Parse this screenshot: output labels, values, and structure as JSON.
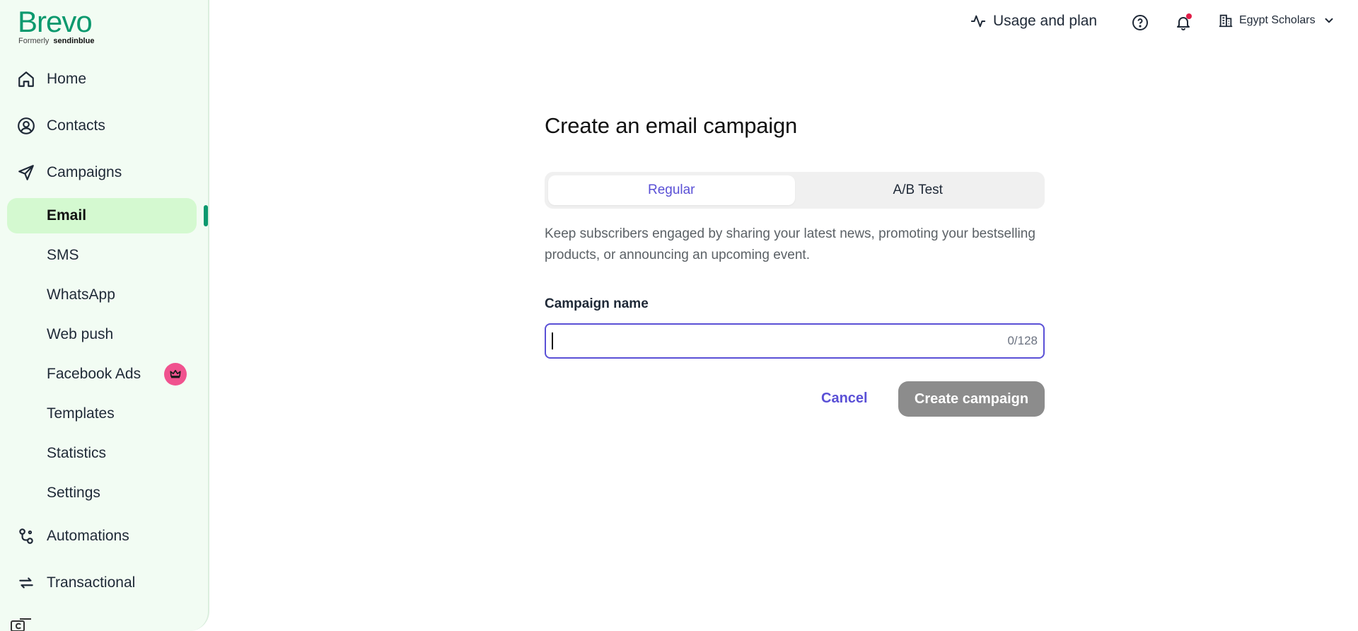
{
  "brand": {
    "name": "Brevo",
    "formerly_label": "Formerly",
    "formerly_name": "sendinblue",
    "color": "#0b996e"
  },
  "sidebar": {
    "main_items": [
      {
        "label": "Home",
        "icon": "home-icon"
      },
      {
        "label": "Contacts",
        "icon": "contacts-icon"
      },
      {
        "label": "Campaigns",
        "icon": "send-icon"
      },
      {
        "label": "Automations",
        "icon": "automations-icon"
      },
      {
        "label": "Transactional",
        "icon": "transactional-icon"
      }
    ],
    "campaign_items": [
      {
        "label": "Email",
        "active": true
      },
      {
        "label": "SMS"
      },
      {
        "label": "WhatsApp"
      },
      {
        "label": "Web push"
      },
      {
        "label": "Facebook Ads",
        "badge": "crown-icon"
      },
      {
        "label": "Templates"
      },
      {
        "label": "Statistics"
      },
      {
        "label": "Settings"
      }
    ]
  },
  "topbar": {
    "usage_label": "Usage and plan",
    "account_name": "Egypt Scholars"
  },
  "main": {
    "title": "Create an email campaign",
    "tabs": [
      {
        "label": "Regular",
        "selected": true
      },
      {
        "label": "A/B Test",
        "selected": false
      }
    ],
    "description": "Keep subscribers engaged by sharing your latest news, promoting your bestselling products, or announcing an upcoming event.",
    "field_label": "Campaign name",
    "field_value": "",
    "counter": "0/128",
    "cancel_label": "Cancel",
    "create_label": "Create campaign"
  },
  "colors": {
    "accent": "#5a50d6",
    "sidebar_bg": "#f2fcf3",
    "active_bg": "#d4f9d0",
    "disabled_button": "#8c8c8c"
  }
}
